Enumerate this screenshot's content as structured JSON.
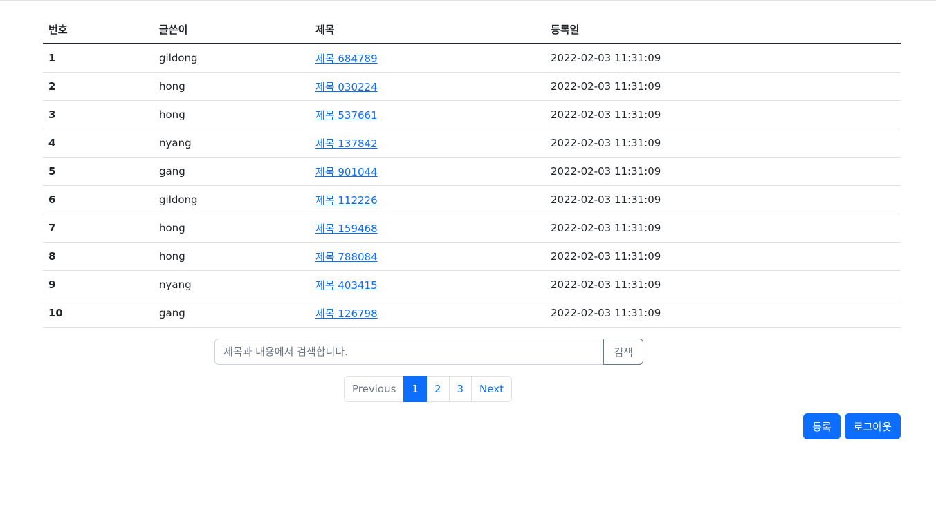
{
  "table": {
    "headers": [
      "번호",
      "글쓴이",
      "제목",
      "등록일"
    ],
    "rows": [
      {
        "num": "1",
        "writer": "gildong",
        "title": "제목 684789",
        "date": "2022-02-03 11:31:09"
      },
      {
        "num": "2",
        "writer": "hong",
        "title": "제목 030224",
        "date": "2022-02-03 11:31:09"
      },
      {
        "num": "3",
        "writer": "hong",
        "title": "제목 537661",
        "date": "2022-02-03 11:31:09"
      },
      {
        "num": "4",
        "writer": "nyang",
        "title": "제목 137842",
        "date": "2022-02-03 11:31:09"
      },
      {
        "num": "5",
        "writer": "gang",
        "title": "제목 901044",
        "date": "2022-02-03 11:31:09"
      },
      {
        "num": "6",
        "writer": "gildong",
        "title": "제목 112226",
        "date": "2022-02-03 11:31:09"
      },
      {
        "num": "7",
        "writer": "hong",
        "title": "제목 159468",
        "date": "2022-02-03 11:31:09"
      },
      {
        "num": "8",
        "writer": "hong",
        "title": "제목 788084",
        "date": "2022-02-03 11:31:09"
      },
      {
        "num": "9",
        "writer": "nyang",
        "title": "제목 403415",
        "date": "2022-02-03 11:31:09"
      },
      {
        "num": "10",
        "writer": "gang",
        "title": "제목 126798",
        "date": "2022-02-03 11:31:09"
      }
    ]
  },
  "search": {
    "placeholder": "제목과 내용에서 검색합니다.",
    "value": "",
    "button_label": "검색"
  },
  "pagination": {
    "previous_label": "Previous",
    "pages": [
      "1",
      "2",
      "3"
    ],
    "active_page": "1",
    "next_label": "Next"
  },
  "actions": {
    "register_label": "등록",
    "logout_label": "로그아웃"
  },
  "colors": {
    "primary": "#0d6efd",
    "border": "#dee2e6",
    "muted": "#6c757d"
  }
}
